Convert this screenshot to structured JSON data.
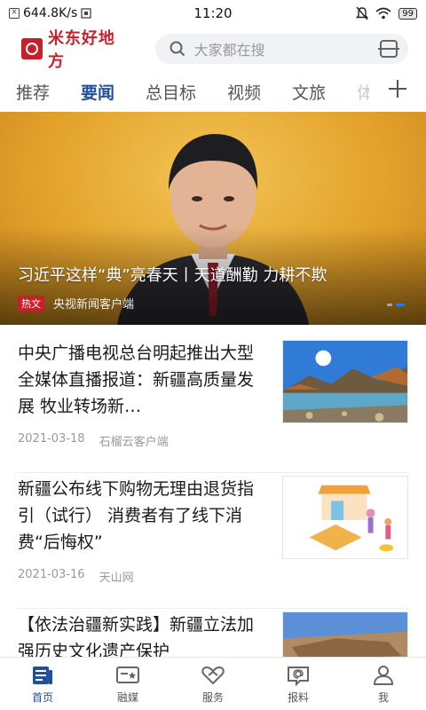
{
  "status_bar": {
    "speed": "644.8K/s",
    "time": "11:20",
    "battery": "99"
  },
  "header": {
    "logo_text": "米东好地方",
    "search_placeholder": "大家都在搜"
  },
  "tabs": [
    {
      "label": "推荐",
      "active": false
    },
    {
      "label": "要闻",
      "active": true
    },
    {
      "label": "总目标",
      "active": false
    },
    {
      "label": "视频",
      "active": false
    },
    {
      "label": "文旅",
      "active": false
    },
    {
      "label": "体",
      "active": false
    }
  ],
  "hero": {
    "title": "习近平这样“典”亮春天丨天道酬勤 力耕不欺",
    "tag": "热文",
    "source": "央视新闻客户端"
  },
  "news": [
    {
      "title": "中央广播电视总台明起推出大型全媒体直播报道：新疆高质量发展 牧业转场新…",
      "date": "2021-03-18",
      "source": "石榴云客户端",
      "thumb": "mountain-lake"
    },
    {
      "title": "新疆公布线下购物无理由退货指引（试行） 消费者有了线下消费“后悔权”",
      "date": "2021-03-16",
      "source": "天山网",
      "thumb": "shopping-illustration"
    },
    {
      "title": "【依法治疆新实践】新疆立法加强历史文化遗产保护",
      "date": "",
      "source": "",
      "thumb": "ancient-ruins"
    }
  ],
  "bottom_nav": [
    {
      "label": "首页",
      "icon": "home-news-icon",
      "active": true
    },
    {
      "label": "融媒",
      "icon": "media-icon",
      "active": false
    },
    {
      "label": "服务",
      "icon": "service-icon",
      "active": false
    },
    {
      "label": "报料",
      "icon": "report-icon",
      "active": false
    },
    {
      "label": "我",
      "icon": "user-icon",
      "active": false
    }
  ]
}
